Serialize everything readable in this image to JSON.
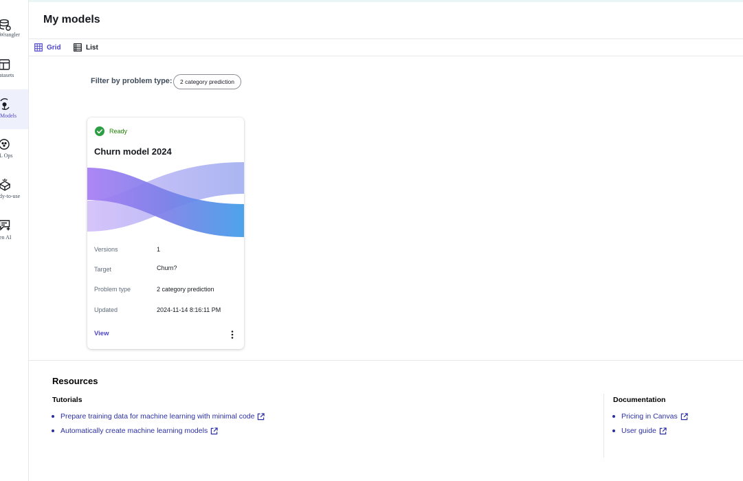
{
  "sidebar": {
    "items": [
      {
        "label": "Wrangler",
        "icon": "data-wrangler-icon"
      },
      {
        "label": "atasets",
        "icon": "datasets-icon"
      },
      {
        "label": "Models",
        "icon": "models-icon",
        "active": true
      },
      {
        "label": "L Ops",
        "icon": "ml-ops-icon"
      },
      {
        "label": "dy-to-use",
        "icon": "ready-to-use-icon"
      },
      {
        "label": "en AI",
        "icon": "gen-ai-icon"
      }
    ]
  },
  "header": {
    "title": "My models"
  },
  "view_toggle": {
    "grid_label": "Grid",
    "list_label": "List",
    "selected": "Grid"
  },
  "filter": {
    "label": "Filter by problem type:",
    "chip": "2 category prediction"
  },
  "model_card": {
    "status": "Ready",
    "title": "Churn model 2024",
    "fields": [
      {
        "key": "Versions",
        "value": "1"
      },
      {
        "key": "Target",
        "value": "Churn?"
      },
      {
        "key": "Problem type",
        "value": "2 category prediction"
      },
      {
        "key": "Updated",
        "value": "2024-11-14 8:16:11 PM"
      }
    ],
    "view_label": "View"
  },
  "resources": {
    "title": "Resources",
    "tutorials": {
      "title": "Tutorials",
      "links": [
        "Prepare training data for machine learning with minimal code",
        "Automatically create machine learning models"
      ]
    },
    "documentation": {
      "title": "Documentation",
      "links": [
        "Pricing in Canvas",
        "User guide"
      ]
    }
  },
  "colors": {
    "accent": "#4f46c8",
    "link": "#2a2fa3",
    "ready": "#1d8102"
  }
}
